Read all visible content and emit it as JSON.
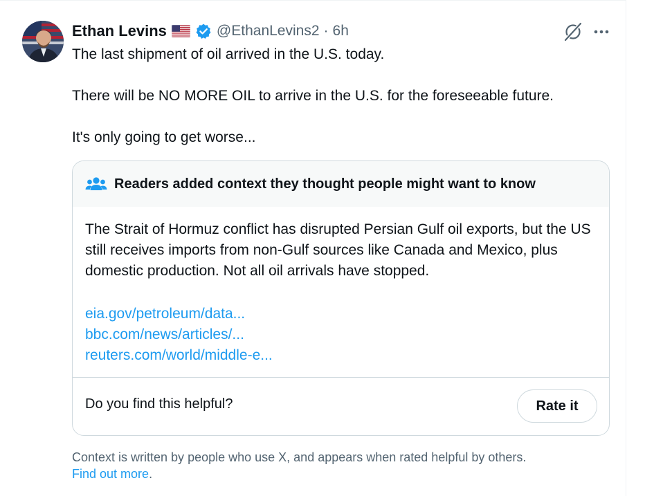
{
  "tweet": {
    "author_name": "Ethan Levins",
    "author_flag": "us-flag-emoji",
    "verified_icon": "verified-badge-icon",
    "handle": "@EthanLevins2",
    "separator": "·",
    "time": "6h",
    "text_lines": [
      "The last shipment of oil arrived in the U.S. today.",
      "There will be NO MORE OIL to arrive in the U.S. for the foreseeable future.",
      "It's only going to get worse..."
    ]
  },
  "actions": {
    "grok_icon": "grok-icon",
    "more_icon": "more-options-icon"
  },
  "community_note": {
    "header_icon": "people-icon",
    "title": "Readers added context they thought people might want to know",
    "body": "The Strait of Hormuz conflict has disrupted Persian Gulf oil exports, but the US still receives imports from non-Gulf sources like Canada and Mexico, plus domestic production. Not all oil arrivals have stopped.",
    "links": [
      "eia.gov/petroleum/data...",
      "bbc.com/news/articles/...",
      "reuters.com/world/middle-e..."
    ],
    "helpful_question": "Do you find this helpful?",
    "rate_button": "Rate it"
  },
  "footer": {
    "text": "Context is written by people who use X, and appears when rated helpful by others.",
    "link": "Find out more",
    "link_suffix": "."
  },
  "colors": {
    "text": "#0f1419",
    "secondary_text": "#536471",
    "link": "#1d9bf0",
    "verified": "#1d9bf0",
    "border": "#cfd9de",
    "note_header_bg": "#f7f9f9"
  }
}
